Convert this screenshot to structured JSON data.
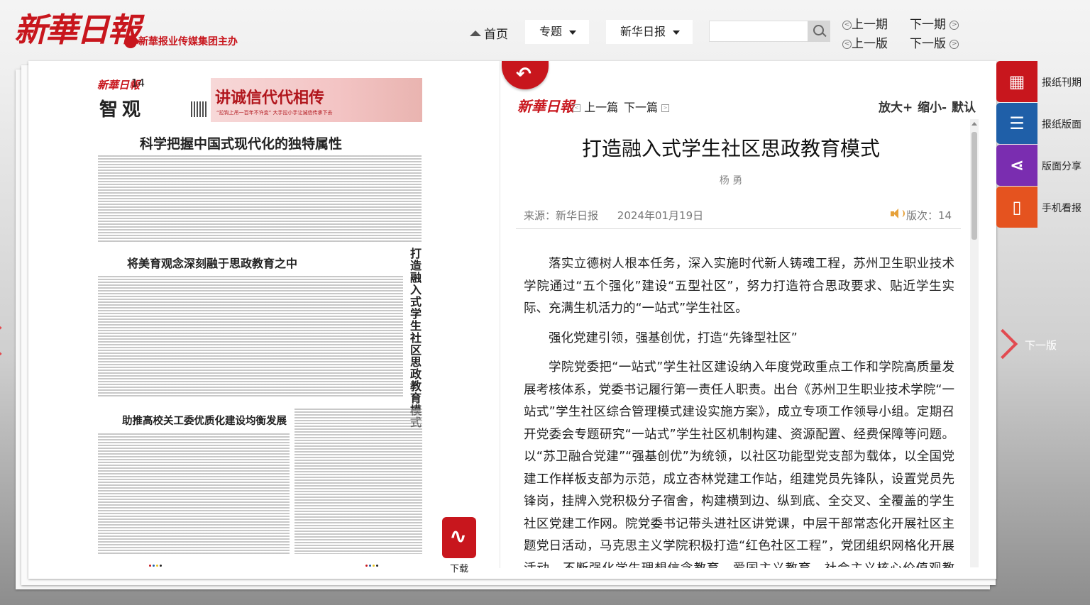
{
  "header": {
    "logo": "新華日報",
    "sublogo": "新華报业传媒集团主办",
    "nav_home": "首页",
    "dropdown_topic": "专题",
    "dropdown_paper": "新华日报",
    "search_placeholder": "",
    "prev_issue": "上一期",
    "next_issue": "下一期",
    "prev_page": "上一版",
    "next_page": "下一版"
  },
  "paper": {
    "logo": "新華日報",
    "page_no": "14",
    "section": "智观",
    "ad_title": "讲诚信代代相传",
    "ad_sub": "“拉钩上吊一百年不许变” 大手拉小手让诚信传承下去",
    "headline1": "科学把握中国式现代化的独特属性",
    "headline2": "将美育观念深刻融于思政教育之中",
    "headline3": "助推高校关工委优质化建设均衡发展",
    "vertical_title": "打造融入式学生社区思政教育模式",
    "download_label": "下载"
  },
  "article": {
    "logo": "新華日報",
    "prev_article": "上一篇",
    "next_article": "下一篇",
    "zoom_in": "放大+",
    "zoom_out": "缩小-",
    "zoom_default": "默认",
    "title": "打造融入式学生社区思政教育模式",
    "author": "杨 勇",
    "source": "来源：新华日报",
    "date": "2024年01月19日",
    "edition": "版次：14",
    "paragraphs": [
      "落实立德树人根本任务，深入实施时代新人铸魂工程，苏州卫生职业技术学院通过“五个强化”建设“五型社区”，努力打造符合思政要求、贴近学生实际、充满生机活力的“一站式”学生社区。",
      "强化党建引领，强基创优，打造“先锋型社区”",
      "学院党委把“一站式”学生社区建设纳入年度党政重点工作和学院高质量发展考核体系，党委书记履行第一责任人职责。出台《苏州卫生职业技术学院“一站式”学生社区综合管理模式建设实施方案》，成立专项工作领导小组。定期召开党委会专题研究“一站式”学生社区机制构建、资源配置、经费保障等问题。以“苏卫融合党建”“强基创优”为统领，以社区功能型党支部为载体，以全国党建工作样板支部为示范，成立杏林党建工作站，组建党员先锋队，设置党员先锋岗，挂牌入党积极分子宿舍，构建横到边、纵到底、全交叉、全覆盖的学生社区党建工作网。院党委书记带头进社区讲党课，中层干部常态化开展社区主题党日活动，马克思主义学院积极打造“红色社区工程”，党团组织网格化开展活动，不断强化学生理想信念教育、爱国主义教育，社会主义核心价值观教育，用党的创新理论铸魂育人。"
    ]
  },
  "sidebar": [
    {
      "label": "报纸刊期",
      "icon": "calendar-icon",
      "color": "#c8161d"
    },
    {
      "label": "报纸版面",
      "icon": "list-icon",
      "color": "#1f5fa8"
    },
    {
      "label": "版面分享",
      "icon": "share-icon",
      "color": "#7a2db0"
    },
    {
      "label": "手机看报",
      "icon": "phone-icon",
      "color": "#e5531f"
    }
  ],
  "next_page_label": "下一版"
}
